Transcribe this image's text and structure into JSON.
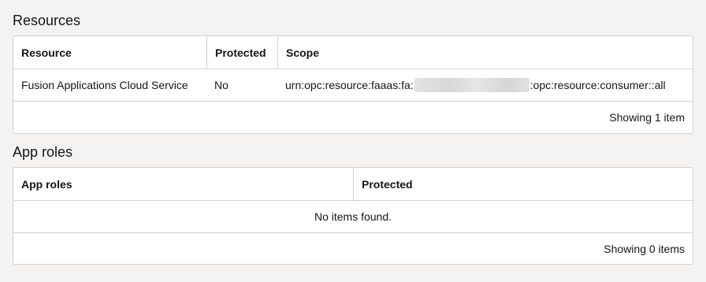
{
  "resources": {
    "title": "Resources",
    "columns": [
      "Resource",
      "Protected",
      "Scope"
    ],
    "rows": [
      {
        "resource": "Fusion Applications Cloud Service",
        "protected": "No",
        "scope_prefix": "urn:opc:resource:faaas:fa:",
        "scope_suffix": ":opc:resource:consumer::all"
      }
    ],
    "footer": "Showing 1 item"
  },
  "app_roles": {
    "title": "App roles",
    "columns": [
      "App roles",
      "Protected"
    ],
    "empty_message": "No items found.",
    "footer": "Showing 0 items"
  }
}
